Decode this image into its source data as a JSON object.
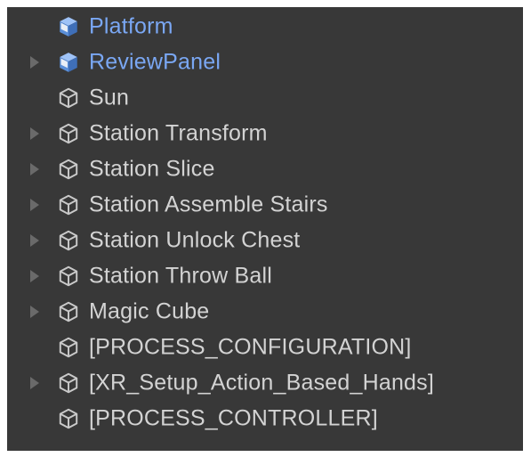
{
  "hierarchy": {
    "items": [
      {
        "label": "Platform",
        "kind": "prefab",
        "expandable": false
      },
      {
        "label": "ReviewPanel",
        "kind": "prefab",
        "expandable": true
      },
      {
        "label": "Sun",
        "kind": "gameobject",
        "expandable": false
      },
      {
        "label": "Station Transform",
        "kind": "gameobject",
        "expandable": true
      },
      {
        "label": "Station Slice",
        "kind": "gameobject",
        "expandable": true
      },
      {
        "label": "Station Assemble Stairs",
        "kind": "gameobject",
        "expandable": true
      },
      {
        "label": "Station Unlock Chest",
        "kind": "gameobject",
        "expandable": true
      },
      {
        "label": "Station Throw Ball",
        "kind": "gameobject",
        "expandable": true
      },
      {
        "label": "Magic Cube",
        "kind": "gameobject",
        "expandable": true
      },
      {
        "label": "[PROCESS_CONFIGURATION]",
        "kind": "gameobject",
        "expandable": false
      },
      {
        "label": "[XR_Setup_Action_Based_Hands]",
        "kind": "gameobject",
        "expandable": true
      },
      {
        "label": "[PROCESS_CONTROLLER]",
        "kind": "gameobject",
        "expandable": false
      }
    ]
  },
  "colors": {
    "panel_background": "#383838",
    "text": "#d3d3d3",
    "prefab_text": "#7aa7f3",
    "expand_arrow": "#6a6a6a"
  },
  "icons": {
    "prefab": "prefab-cube-icon",
    "gameobject": "gameobject-cube-icon",
    "expand": "expand-arrow-icon"
  }
}
